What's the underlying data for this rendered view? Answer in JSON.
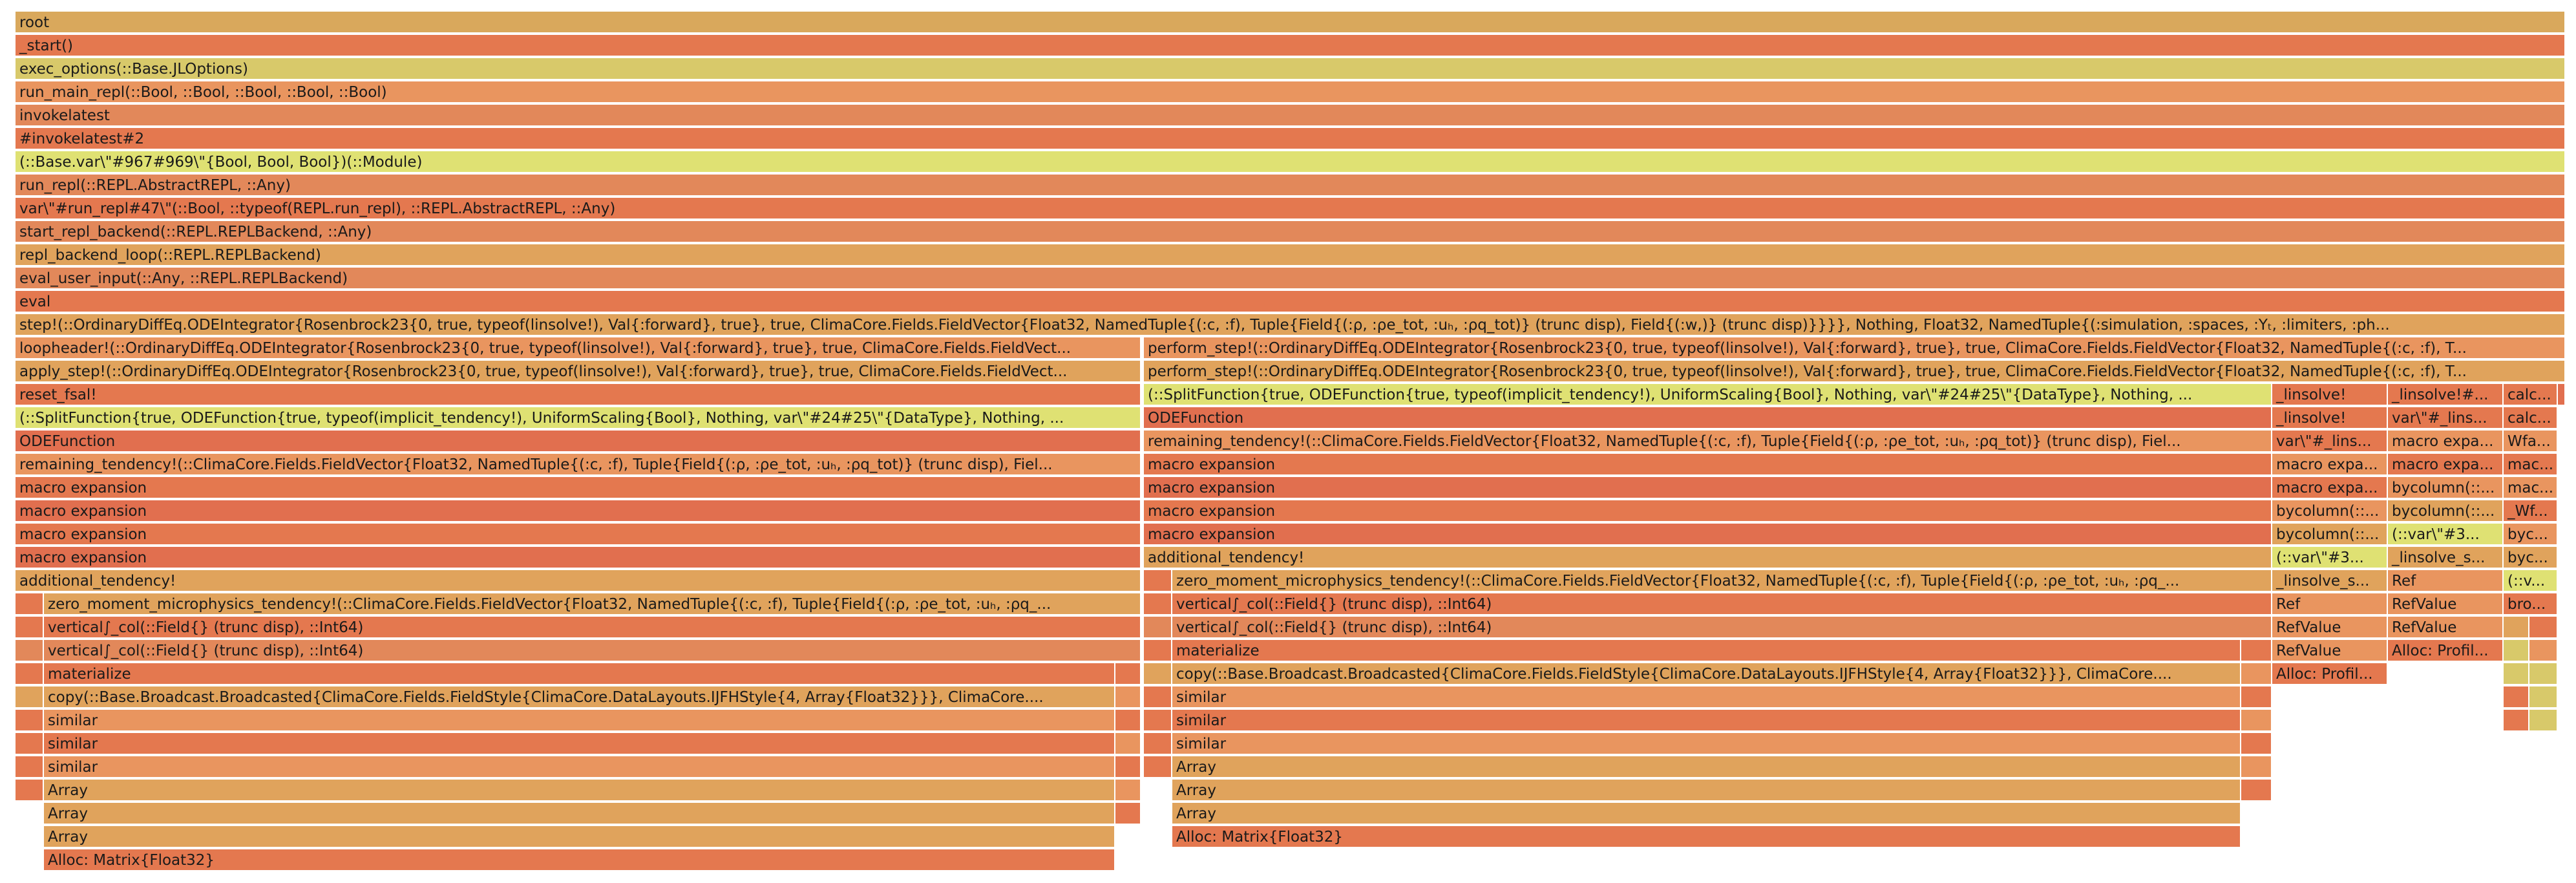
{
  "palette": {
    "c1": "#d9a85c",
    "c2": "#e4784f",
    "c3": "#e0a35c",
    "c4": "#e2885a",
    "c5": "#d8c96a",
    "c6": "#e9955f",
    "c7": "#dfe173",
    "c8": "#e16f4f",
    "c9": "#d6b968"
  },
  "frames": [
    {
      "label": "root",
      "color": "c1",
      "row": 0,
      "start": 0.006,
      "end": 0.996
    },
    {
      "label": "_start()",
      "color": "c2",
      "row": 1,
      "start": 0.006,
      "end": 0.996
    },
    {
      "label": "exec_options(::Base.JLOptions)",
      "color": "c5",
      "row": 2,
      "start": 0.006,
      "end": 0.996
    },
    {
      "label": "run_main_repl(::Bool, ::Bool, ::Bool, ::Bool, ::Bool)",
      "color": "c6",
      "row": 3,
      "start": 0.006,
      "end": 0.996
    },
    {
      "label": "invokelatest",
      "color": "c4",
      "row": 4,
      "start": 0.006,
      "end": 0.996
    },
    {
      "label": "#invokelatest#2",
      "color": "c2",
      "row": 5,
      "start": 0.006,
      "end": 0.996
    },
    {
      "label": "(::Base.var\\\"#967#969\\\"{Bool, Bool, Bool})(::Module)",
      "color": "c7",
      "row": 6,
      "start": 0.006,
      "end": 0.996
    },
    {
      "label": "run_repl(::REPL.AbstractREPL, ::Any)",
      "color": "c4",
      "row": 7,
      "start": 0.006,
      "end": 0.996
    },
    {
      "label": "var\\\"#run_repl#47\\\"(::Bool, ::typeof(REPL.run_repl), ::REPL.AbstractREPL, ::Any)",
      "color": "c2",
      "row": 8,
      "start": 0.006,
      "end": 0.996
    },
    {
      "label": "start_repl_backend(::REPL.REPLBackend, ::Any)",
      "color": "c4",
      "row": 9,
      "start": 0.006,
      "end": 0.996
    },
    {
      "label": "repl_backend_loop(::REPL.REPLBackend)",
      "color": "c3",
      "row": 10,
      "start": 0.006,
      "end": 0.996
    },
    {
      "label": "eval_user_input(::Any, ::REPL.REPLBackend)",
      "color": "c4",
      "row": 11,
      "start": 0.006,
      "end": 0.996
    },
    {
      "label": "eval",
      "color": "c2",
      "row": 12,
      "start": 0.006,
      "end": 0.996
    },
    {
      "label": "step!(::OrdinaryDiffEq.ODEIntegrator{Rosenbrock23{0, true, typeof(linsolve!), Val{:forward}, true}, true, ClimaCore.Fields.FieldVector{Float32, NamedTuple{(:c, :f), Tuple{Field{(:ρ, :ρe_tot, :uₕ, :ρq_tot)} (trunc disp), Field{(:w,)} (trunc disp)}}}}, Nothing, Float32, NamedTuple{(:simulation, :spaces, :Yₜ, :limiters, :ph...",
      "color": "c3",
      "row": 13,
      "start": 0.006,
      "end": 0.996
    },
    {
      "label": "loopheader!(::OrdinaryDiffEq.ODEIntegrator{Rosenbrock23{0, true, typeof(linsolve!), Val{:forward}, true}, true, ClimaCore.Fields.FieldVect...",
      "color": "c6",
      "row": 14,
      "start": 0.006,
      "end": 0.443
    },
    {
      "label": "apply_step!(::OrdinaryDiffEq.ODEIntegrator{Rosenbrock23{0, true, typeof(linsolve!), Val{:forward}, true}, true, ClimaCore.Fields.FieldVect...",
      "color": "c3",
      "row": 15,
      "start": 0.006,
      "end": 0.443
    },
    {
      "label": "reset_fsal!",
      "color": "c2",
      "row": 16,
      "start": 0.006,
      "end": 0.443
    },
    {
      "label": "(::SplitFunction{true, ODEFunction{true, typeof(implicit_tendency!), UniformScaling{Bool}, Nothing, var\\\"#24#25\\\"{DataType}, Nothing, ...",
      "color": "c7",
      "row": 17,
      "start": 0.006,
      "end": 0.443
    },
    {
      "label": "ODEFunction",
      "color": "c8",
      "row": 18,
      "start": 0.006,
      "end": 0.443
    },
    {
      "label": "remaining_tendency!(::ClimaCore.Fields.FieldVector{Float32, NamedTuple{(:c, :f), Tuple{Field{(:ρ, :ρe_tot, :uₕ, :ρq_tot)} (trunc disp), Fiel...",
      "color": "c6",
      "row": 19,
      "start": 0.006,
      "end": 0.443
    },
    {
      "label": "macro expansion",
      "color": "c2",
      "row": 20,
      "start": 0.006,
      "end": 0.443
    },
    {
      "label": "macro expansion",
      "color": "c8",
      "row": 21,
      "start": 0.006,
      "end": 0.443
    },
    {
      "label": "macro expansion",
      "color": "c2",
      "row": 22,
      "start": 0.006,
      "end": 0.443
    },
    {
      "label": "macro expansion",
      "color": "c8",
      "row": 23,
      "start": 0.006,
      "end": 0.443
    },
    {
      "label": "additional_tendency!",
      "color": "c3",
      "row": 24,
      "start": 0.006,
      "end": 0.443
    },
    {
      "label": "",
      "color": "c2",
      "row": 25,
      "start": 0.006,
      "end": 0.017
    },
    {
      "label": "zero_moment_microphysics_tendency!(::ClimaCore.Fields.FieldVector{Float32, NamedTuple{(:c, :f), Tuple{Field{(:ρ, :ρe_tot, :uₕ, :ρq_...",
      "color": "c3",
      "row": 25,
      "start": 0.017,
      "end": 0.443
    },
    {
      "label": "",
      "color": "c2",
      "row": 26,
      "start": 0.006,
      "end": 0.017
    },
    {
      "label": "vertical∫_col(::Field{} (trunc disp), ::Int64)",
      "color": "c2",
      "row": 26,
      "start": 0.017,
      "end": 0.443
    },
    {
      "label": "",
      "color": "c4",
      "row": 27,
      "start": 0.006,
      "end": 0.017
    },
    {
      "label": "vertical∫_col(::Field{} (trunc disp), ::Int64)",
      "color": "c4",
      "row": 27,
      "start": 0.017,
      "end": 0.443
    },
    {
      "label": "",
      "color": "c2",
      "row": 28,
      "start": 0.006,
      "end": 0.017
    },
    {
      "label": "materialize",
      "color": "c2",
      "row": 28,
      "start": 0.017,
      "end": 0.433
    },
    {
      "label": "",
      "color": "c2",
      "row": 28,
      "start": 0.433,
      "end": 0.443
    },
    {
      "label": "",
      "color": "c3",
      "row": 29,
      "start": 0.006,
      "end": 0.017
    },
    {
      "label": "copy(::Base.Broadcast.Broadcasted{ClimaCore.Fields.FieldStyle{ClimaCore.DataLayouts.IJFHStyle{4, Array{Float32}}}, ClimaCore....",
      "color": "c3",
      "row": 29,
      "start": 0.017,
      "end": 0.433
    },
    {
      "label": "",
      "color": "c6",
      "row": 29,
      "start": 0.433,
      "end": 0.443
    },
    {
      "label": "",
      "color": "c2",
      "row": 30,
      "start": 0.006,
      "end": 0.017
    },
    {
      "label": "similar",
      "color": "c6",
      "row": 30,
      "start": 0.017,
      "end": 0.433
    },
    {
      "label": "",
      "color": "c2",
      "row": 30,
      "start": 0.433,
      "end": 0.443
    },
    {
      "label": "",
      "color": "c2",
      "row": 31,
      "start": 0.006,
      "end": 0.017
    },
    {
      "label": "similar",
      "color": "c2",
      "row": 31,
      "start": 0.017,
      "end": 0.433
    },
    {
      "label": "",
      "color": "c6",
      "row": 31,
      "start": 0.433,
      "end": 0.443
    },
    {
      "label": "",
      "color": "c2",
      "row": 32,
      "start": 0.006,
      "end": 0.017
    },
    {
      "label": "similar",
      "color": "c6",
      "row": 32,
      "start": 0.017,
      "end": 0.433
    },
    {
      "label": "",
      "color": "c2",
      "row": 32,
      "start": 0.433,
      "end": 0.443
    },
    {
      "label": "",
      "color": "c2",
      "row": 33,
      "start": 0.006,
      "end": 0.017
    },
    {
      "label": "Array",
      "color": "c3",
      "row": 33,
      "start": 0.017,
      "end": 0.433
    },
    {
      "label": "",
      "color": "c6",
      "row": 33,
      "start": 0.433,
      "end": 0.443
    },
    {
      "label": "Array",
      "color": "c3",
      "row": 34,
      "start": 0.017,
      "end": 0.433
    },
    {
      "label": "",
      "color": "c2",
      "row": 34,
      "start": 0.433,
      "end": 0.443
    },
    {
      "label": "Array",
      "color": "c3",
      "row": 35,
      "start": 0.017,
      "end": 0.433
    },
    {
      "label": "Alloc: Matrix{Float32}",
      "color": "c2",
      "row": 36,
      "start": 0.017,
      "end": 0.433
    },
    {
      "label": "perform_step!(::OrdinaryDiffEq.ODEIntegrator{Rosenbrock23{0, true, typeof(linsolve!), Val{:forward}, true}, true, ClimaCore.Fields.FieldVector{Float32, NamedTuple{(:c, :f), T...",
      "color": "c6",
      "row": 14,
      "start": 0.444,
      "end": 0.996
    },
    {
      "label": "perform_step!(::OrdinaryDiffEq.ODEIntegrator{Rosenbrock23{0, true, typeof(linsolve!), Val{:forward}, true}, true, ClimaCore.Fields.FieldVector{Float32, NamedTuple{(:c, :f), T...",
      "color": "c3",
      "row": 15,
      "start": 0.444,
      "end": 0.996
    },
    {
      "label": "(::SplitFunction{true, ODEFunction{true, typeof(implicit_tendency!), UniformScaling{Bool}, Nothing, var\\\"#24#25\\\"{DataType}, Nothing, ...",
      "color": "c7",
      "row": 16,
      "start": 0.444,
      "end": 0.882
    },
    {
      "label": "ODEFunction",
      "color": "c8",
      "row": 17,
      "start": 0.444,
      "end": 0.882
    },
    {
      "label": "remaining_tendency!(::ClimaCore.Fields.FieldVector{Float32, NamedTuple{(:c, :f), Tuple{Field{(:ρ, :ρe_tot, :uₕ, :ρq_tot)} (trunc disp), Fiel...",
      "color": "c6",
      "row": 18,
      "start": 0.444,
      "end": 0.882
    },
    {
      "label": "macro expansion",
      "color": "c2",
      "row": 19,
      "start": 0.444,
      "end": 0.882
    },
    {
      "label": "macro expansion",
      "color": "c8",
      "row": 20,
      "start": 0.444,
      "end": 0.882
    },
    {
      "label": "macro expansion",
      "color": "c2",
      "row": 21,
      "start": 0.444,
      "end": 0.882
    },
    {
      "label": "macro expansion",
      "color": "c8",
      "row": 22,
      "start": 0.444,
      "end": 0.882
    },
    {
      "label": "additional_tendency!",
      "color": "c3",
      "row": 23,
      "start": 0.444,
      "end": 0.882
    },
    {
      "label": "",
      "color": "c2",
      "row": 24,
      "start": 0.444,
      "end": 0.455
    },
    {
      "label": "zero_moment_microphysics_tendency!(::ClimaCore.Fields.FieldVector{Float32, NamedTuple{(:c, :f), Tuple{Field{(:ρ, :ρe_tot, :uₕ, :ρq_...",
      "color": "c3",
      "row": 24,
      "start": 0.455,
      "end": 0.882
    },
    {
      "label": "",
      "color": "c2",
      "row": 25,
      "start": 0.444,
      "end": 0.455
    },
    {
      "label": "vertical∫_col(::Field{} (trunc disp), ::Int64)",
      "color": "c2",
      "row": 25,
      "start": 0.455,
      "end": 0.882
    },
    {
      "label": "",
      "color": "c4",
      "row": 26,
      "start": 0.444,
      "end": 0.455
    },
    {
      "label": "vertical∫_col(::Field{} (trunc disp), ::Int64)",
      "color": "c4",
      "row": 26,
      "start": 0.455,
      "end": 0.882
    },
    {
      "label": "",
      "color": "c2",
      "row": 27,
      "start": 0.444,
      "end": 0.455
    },
    {
      "label": "materialize",
      "color": "c2",
      "row": 27,
      "start": 0.455,
      "end": 0.87
    },
    {
      "label": "",
      "color": "c2",
      "row": 27,
      "start": 0.87,
      "end": 0.882
    },
    {
      "label": "",
      "color": "c3",
      "row": 28,
      "start": 0.444,
      "end": 0.455
    },
    {
      "label": "copy(::Base.Broadcast.Broadcasted{ClimaCore.Fields.FieldStyle{ClimaCore.DataLayouts.IJFHStyle{4, Array{Float32}}}, ClimaCore....",
      "color": "c3",
      "row": 28,
      "start": 0.455,
      "end": 0.87
    },
    {
      "label": "",
      "color": "c6",
      "row": 28,
      "start": 0.87,
      "end": 0.882
    },
    {
      "label": "",
      "color": "c2",
      "row": 29,
      "start": 0.444,
      "end": 0.455
    },
    {
      "label": "similar",
      "color": "c6",
      "row": 29,
      "start": 0.455,
      "end": 0.87
    },
    {
      "label": "",
      "color": "c2",
      "row": 29,
      "start": 0.87,
      "end": 0.882
    },
    {
      "label": "",
      "color": "c2",
      "row": 30,
      "start": 0.444,
      "end": 0.455
    },
    {
      "label": "similar",
      "color": "c2",
      "row": 30,
      "start": 0.455,
      "end": 0.87
    },
    {
      "label": "",
      "color": "c6",
      "row": 30,
      "start": 0.87,
      "end": 0.882
    },
    {
      "label": "",
      "color": "c2",
      "row": 31,
      "start": 0.444,
      "end": 0.455
    },
    {
      "label": "similar",
      "color": "c6",
      "row": 31,
      "start": 0.455,
      "end": 0.87
    },
    {
      "label": "",
      "color": "c2",
      "row": 31,
      "start": 0.87,
      "end": 0.882
    },
    {
      "label": "",
      "color": "c2",
      "row": 32,
      "start": 0.444,
      "end": 0.455
    },
    {
      "label": "Array",
      "color": "c3",
      "row": 32,
      "start": 0.455,
      "end": 0.87
    },
    {
      "label": "",
      "color": "c6",
      "row": 32,
      "start": 0.87,
      "end": 0.882
    },
    {
      "label": "Array",
      "color": "c3",
      "row": 33,
      "start": 0.455,
      "end": 0.87
    },
    {
      "label": "",
      "color": "c2",
      "row": 33,
      "start": 0.87,
      "end": 0.882
    },
    {
      "label": "Array",
      "color": "c3",
      "row": 34,
      "start": 0.455,
      "end": 0.87
    },
    {
      "label": "Alloc: Matrix{Float32}",
      "color": "c2",
      "row": 35,
      "start": 0.455,
      "end": 0.87
    },
    {
      "label": "_linsolve!",
      "color": "c2",
      "row": 16,
      "start": 0.882,
      "end": 0.927
    },
    {
      "label": "_linsolve!",
      "color": "c2",
      "row": 17,
      "start": 0.882,
      "end": 0.927
    },
    {
      "label": "var\\\"#_lins...",
      "color": "c2",
      "row": 18,
      "start": 0.882,
      "end": 0.927
    },
    {
      "label": "macro expa...",
      "color": "c6",
      "row": 19,
      "start": 0.882,
      "end": 0.927
    },
    {
      "label": "macro expa...",
      "color": "c2",
      "row": 20,
      "start": 0.882,
      "end": 0.927
    },
    {
      "label": "bycolumn(::...",
      "color": "c6",
      "row": 21,
      "start": 0.882,
      "end": 0.927
    },
    {
      "label": "bycolumn(::...",
      "color": "c3",
      "row": 22,
      "start": 0.882,
      "end": 0.927
    },
    {
      "label": "(::var\\\"#3...",
      "color": "c7",
      "row": 23,
      "start": 0.882,
      "end": 0.927
    },
    {
      "label": "_linsolve_s...",
      "color": "c3",
      "row": 24,
      "start": 0.882,
      "end": 0.927
    },
    {
      "label": "Ref",
      "color": "c6",
      "row": 25,
      "start": 0.882,
      "end": 0.927
    },
    {
      "label": "RefValue",
      "color": "c6",
      "row": 26,
      "start": 0.882,
      "end": 0.927
    },
    {
      "label": "RefValue",
      "color": "c6",
      "row": 27,
      "start": 0.882,
      "end": 0.927
    },
    {
      "label": "Alloc: Profil...",
      "color": "c2",
      "row": 28,
      "start": 0.882,
      "end": 0.927
    },
    {
      "label": "_linsolve!#...",
      "color": "c2",
      "row": 16,
      "start": 0.927,
      "end": 0.972
    },
    {
      "label": "var\\\"#_lins...",
      "color": "c2",
      "row": 17,
      "start": 0.927,
      "end": 0.972
    },
    {
      "label": "macro expa...",
      "color": "c6",
      "row": 18,
      "start": 0.927,
      "end": 0.972
    },
    {
      "label": "macro expa...",
      "color": "c2",
      "row": 19,
      "start": 0.927,
      "end": 0.972
    },
    {
      "label": "bycolumn(::...",
      "color": "c6",
      "row": 20,
      "start": 0.927,
      "end": 0.972
    },
    {
      "label": "bycolumn(::...",
      "color": "c3",
      "row": 21,
      "start": 0.927,
      "end": 0.972
    },
    {
      "label": "(::var\\\"#3...",
      "color": "c7",
      "row": 22,
      "start": 0.927,
      "end": 0.972
    },
    {
      "label": "_linsolve_s...",
      "color": "c3",
      "row": 23,
      "start": 0.927,
      "end": 0.972
    },
    {
      "label": "Ref",
      "color": "c6",
      "row": 24,
      "start": 0.927,
      "end": 0.972
    },
    {
      "label": "RefValue",
      "color": "c6",
      "row": 25,
      "start": 0.927,
      "end": 0.972
    },
    {
      "label": "RefValue",
      "color": "c6",
      "row": 26,
      "start": 0.927,
      "end": 0.972
    },
    {
      "label": "Alloc: Profil...",
      "color": "c2",
      "row": 27,
      "start": 0.927,
      "end": 0.972
    },
    {
      "label": "calc...",
      "color": "c2",
      "row": 16,
      "start": 0.972,
      "end": 0.993
    },
    {
      "label": "",
      "color": "c8",
      "row": 16,
      "start": 0.993,
      "end": 0.996
    },
    {
      "label": "calc...",
      "color": "c2",
      "row": 17,
      "start": 0.972,
      "end": 0.993
    },
    {
      "label": "Wfa...",
      "color": "c6",
      "row": 18,
      "start": 0.972,
      "end": 0.993
    },
    {
      "label": "mac...",
      "color": "c2",
      "row": 19,
      "start": 0.972,
      "end": 0.993
    },
    {
      "label": "mac...",
      "color": "c6",
      "row": 20,
      "start": 0.972,
      "end": 0.993
    },
    {
      "label": "_Wf...",
      "color": "c2",
      "row": 21,
      "start": 0.972,
      "end": 0.993
    },
    {
      "label": "byc...",
      "color": "c6",
      "row": 22,
      "start": 0.972,
      "end": 0.993
    },
    {
      "label": "byc...",
      "color": "c3",
      "row": 23,
      "start": 0.972,
      "end": 0.993
    },
    {
      "label": "(::v...",
      "color": "c7",
      "row": 24,
      "start": 0.972,
      "end": 0.993
    },
    {
      "label": "bro...",
      "color": "c2",
      "row": 25,
      "start": 0.972,
      "end": 0.993
    },
    {
      "label": "",
      "color": "c3",
      "row": 26,
      "start": 0.972,
      "end": 0.982
    },
    {
      "label": "",
      "color": "c2",
      "row": 26,
      "start": 0.982,
      "end": 0.993
    },
    {
      "label": "",
      "color": "c5",
      "row": 27,
      "start": 0.972,
      "end": 0.982
    },
    {
      "label": "",
      "color": "c6",
      "row": 27,
      "start": 0.982,
      "end": 0.993
    },
    {
      "label": "",
      "color": "c5",
      "row": 28,
      "start": 0.972,
      "end": 0.982
    },
    {
      "label": "",
      "color": "c5",
      "row": 28,
      "start": 0.982,
      "end": 0.993
    },
    {
      "label": "",
      "color": "c2",
      "row": 29,
      "start": 0.972,
      "end": 0.982
    },
    {
      "label": "",
      "color": "c5",
      "row": 29,
      "start": 0.982,
      "end": 0.993
    },
    {
      "label": "",
      "color": "c2",
      "row": 30,
      "start": 0.972,
      "end": 0.982
    },
    {
      "label": "",
      "color": "c5",
      "row": 30,
      "start": 0.982,
      "end": 0.993
    }
  ]
}
